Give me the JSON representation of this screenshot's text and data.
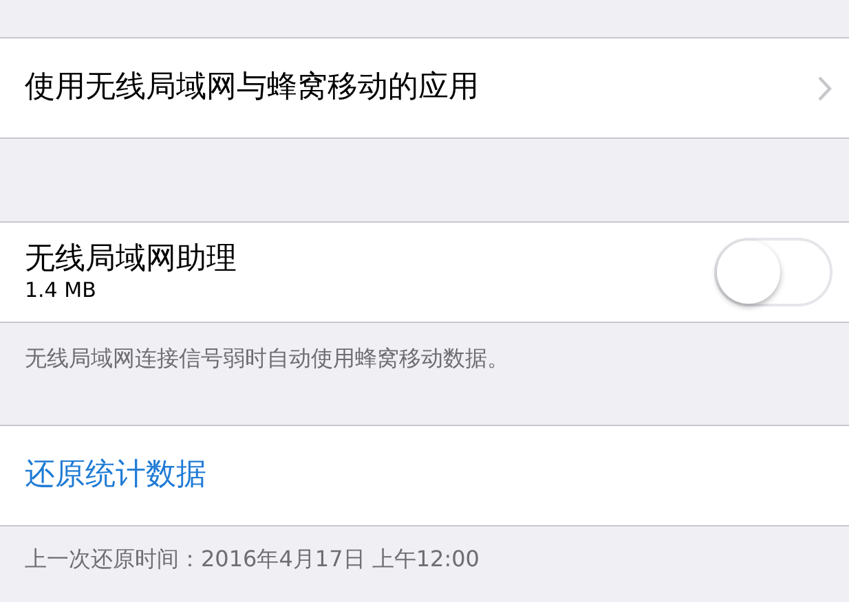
{
  "rows": [
    {
      "kind": "nav",
      "title": "使用无线局域网与蜂窝移动的应用"
    },
    {
      "kind": "toggle",
      "title": "无线局域网助理",
      "subtitle": "1.4 MB",
      "on": false,
      "footer": "无线局域网连接信号弱时自动使用蜂窝移动数据。"
    },
    {
      "kind": "action",
      "title": "还原统计数据",
      "footer": "上一次还原时间：2016年4月17日 上午12:00"
    }
  ]
}
